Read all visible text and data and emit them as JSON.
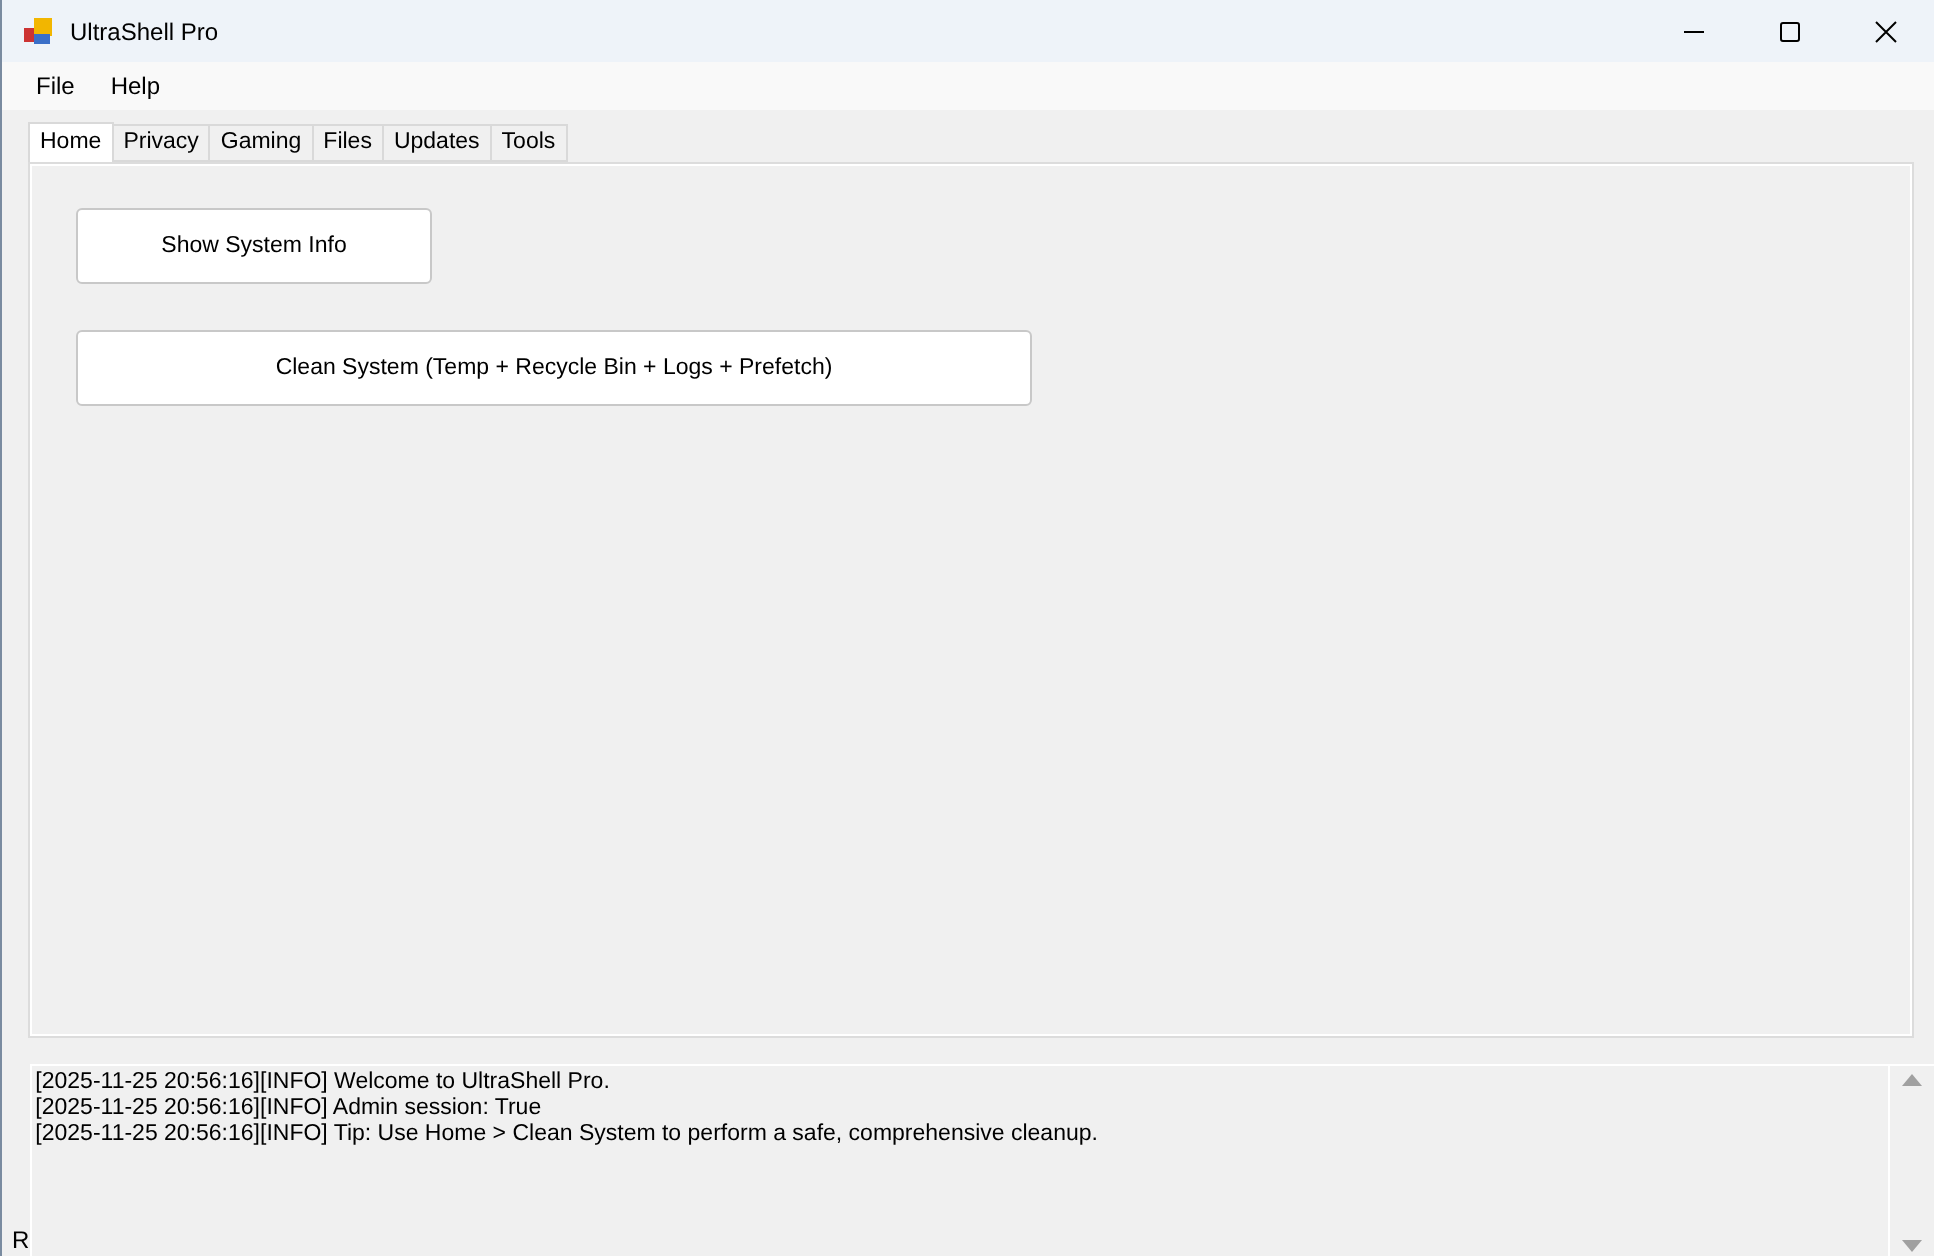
{
  "window": {
    "title": "UltraShell Pro"
  },
  "menu": [
    "File",
    "Help"
  ],
  "tabs": [
    {
      "label": "Home",
      "selected": true
    },
    {
      "label": "Privacy",
      "selected": false
    },
    {
      "label": "Gaming",
      "selected": false
    },
    {
      "label": "Files",
      "selected": false
    },
    {
      "label": "Updates",
      "selected": false
    },
    {
      "label": "Tools",
      "selected": false
    }
  ],
  "home_buttons": [
    {
      "label": "Show System Info",
      "kind": "short"
    },
    {
      "label": "Clean System (Temp + Recycle Bin + Logs + Prefetch)",
      "kind": "wide"
    }
  ],
  "log": [
    "[2025-11-25 20:56:16][INFO] Welcome to UltraShell Pro.",
    "[2025-11-25 20:56:16][INFO] Admin session: True",
    "[2025-11-25 20:56:16][INFO] Tip: Use Home > Clean System to perform a safe, comprehensive cleanup."
  ],
  "status_bar": {
    "text": "R"
  }
}
